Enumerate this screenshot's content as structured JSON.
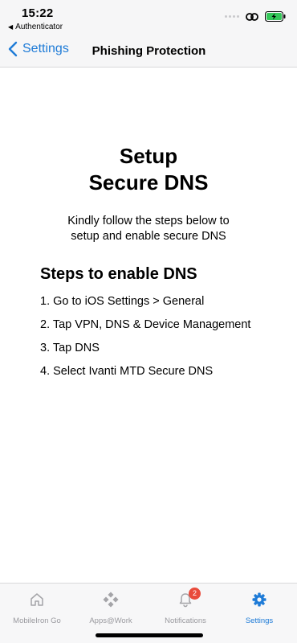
{
  "status_bar": {
    "time": "15:22",
    "back_app": "Authenticator",
    "icons": [
      "link-icon",
      "battery-charging-icon"
    ]
  },
  "nav": {
    "back_label": "Settings",
    "title": "Phishing Protection"
  },
  "main": {
    "title_line1": "Setup",
    "title_line2": "Secure DNS",
    "intro_line1": "Kindly follow the steps below to",
    "intro_line2": "setup and enable secure DNS",
    "steps_heading": "Steps to enable DNS",
    "steps": [
      "1. Go to iOS Settings > General",
      "2. Tap VPN, DNS & Device Management",
      "3. Tap DNS",
      "4. Select Ivanti MTD Secure DNS"
    ]
  },
  "tab_bar": {
    "tabs": [
      {
        "label": "MobileIron Go",
        "icon": "home-icon",
        "active": false
      },
      {
        "label": "Apps@Work",
        "icon": "apps-diamond-icon",
        "active": false
      },
      {
        "label": "Notifications",
        "icon": "bell-icon",
        "active": false,
        "badge": "2"
      },
      {
        "label": "Settings",
        "icon": "gear-icon",
        "active": true
      }
    ]
  },
  "colors": {
    "accent": "#1e7bd7",
    "badge": "#e94b3c",
    "battery": "#34c759",
    "inactive": "#9a9a9f"
  }
}
